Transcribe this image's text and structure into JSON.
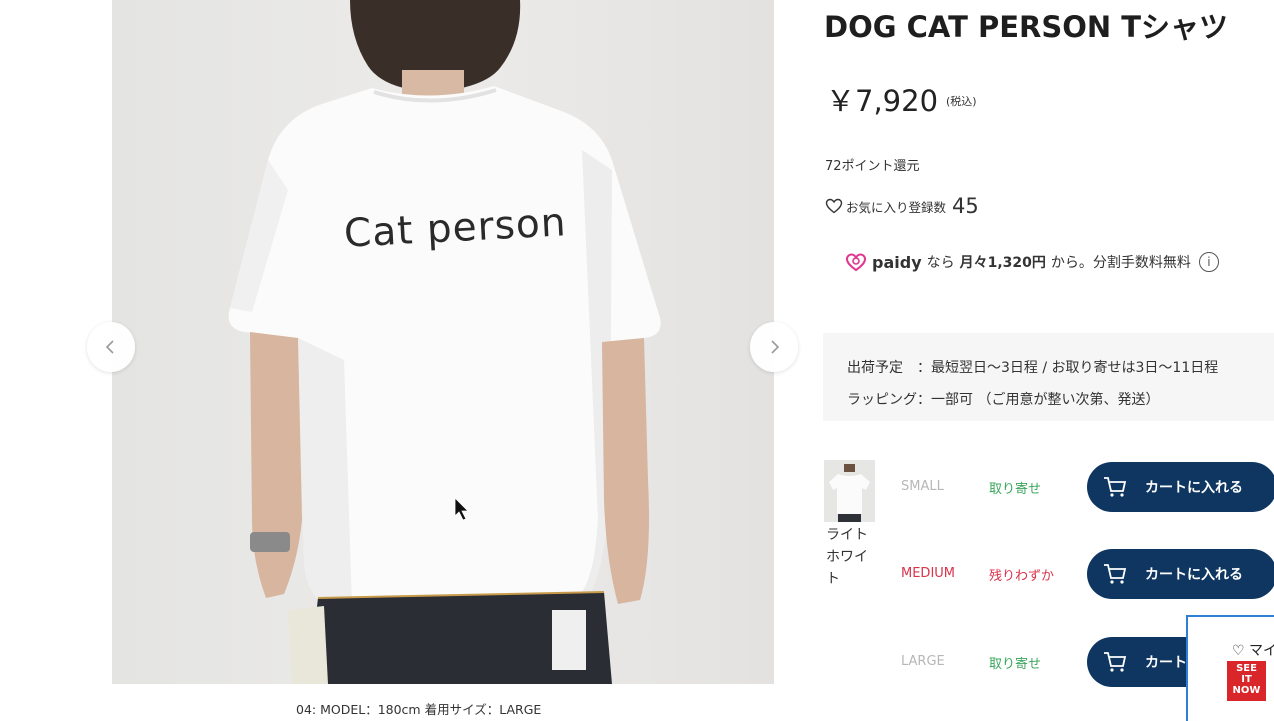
{
  "gallery": {
    "shirt_print": "Cat person",
    "caption": "04: MODEL：180cm 着用サイズ：LARGE",
    "prev_icon": "chevron-left-icon",
    "next_icon": "chevron-right-icon"
  },
  "product": {
    "title": "DOG CAT PERSON Tシャツ",
    "price": "￥7,920",
    "tax_note": "(税込)",
    "points": "72ポイント還元",
    "favorites_label": "お気に入り登録数",
    "favorites_count": "45"
  },
  "paidy": {
    "brand": "paidy",
    "text_prefix": "なら",
    "monthly": "月々1,320円",
    "text_suffix": "から。分割手数料無料",
    "info_icon": "info-icon"
  },
  "shipping": {
    "row1": "出荷予定　：最短翌日〜3日程 / お取り寄せは3日〜11日程",
    "row2": "ラッピング：一部可 （ご用意が整い次第、発送）"
  },
  "variant": {
    "color_name": "ライトホワイト",
    "sizes": [
      {
        "size": "SMALL",
        "stock": "取り寄せ",
        "button": "カートに入れる"
      },
      {
        "size": "MEDIUM",
        "stock": "残りわずか",
        "button": "カートに入れる"
      },
      {
        "size": "LARGE",
        "stock": "取り寄せ",
        "button": "カート"
      }
    ]
  },
  "overlay": {
    "popup_label": "♡ マイ",
    "badge_line1": "SEE",
    "badge_line2": "IT",
    "badge_line3": "NOW"
  },
  "colors": {
    "cart_button": "#0e3660",
    "stock_green": "#39a55b",
    "stock_red": "#d8334a",
    "muted_size": "#b7b7b7",
    "paidy_pink": "#e0368f"
  }
}
